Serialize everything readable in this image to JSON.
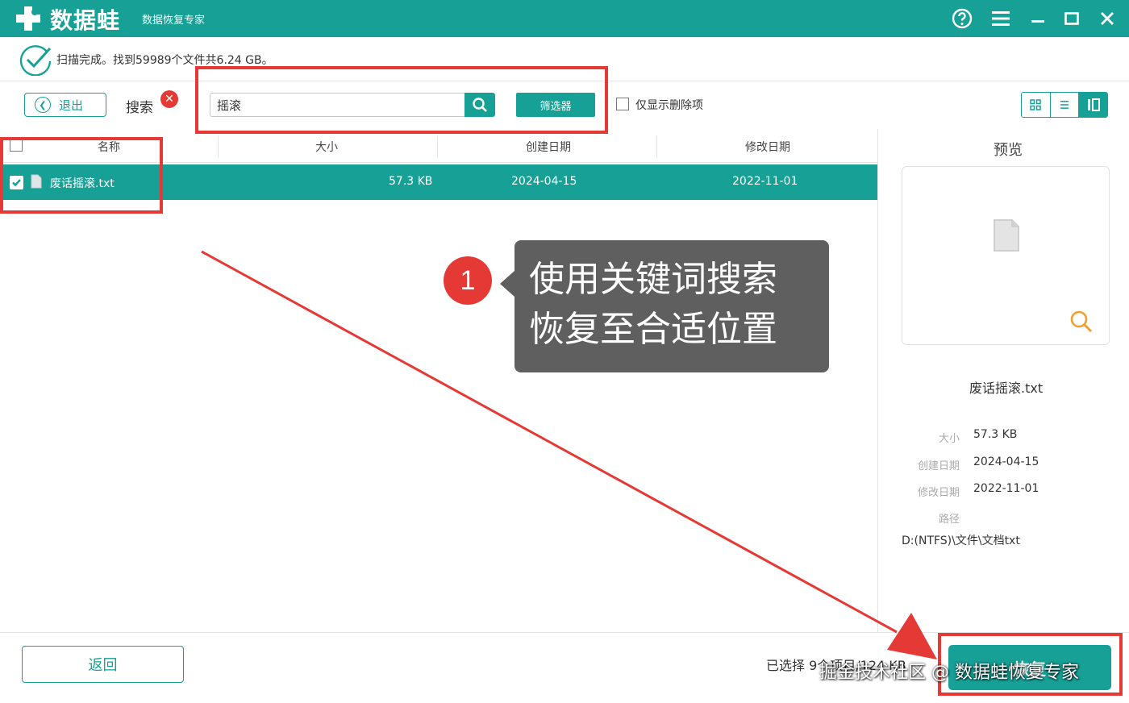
{
  "app": {
    "name": "数据蛙",
    "subtitle": "数据恢复专家"
  },
  "status": {
    "text": "扫描完成。找到59989个文件共6.24 GB。"
  },
  "toolbar": {
    "exit_label": "退出",
    "search_label": "搜索",
    "search_value": "摇滚",
    "filter_label": "筛选器",
    "only_deleted_label": "仅显示删除项"
  },
  "table": {
    "columns": [
      "名称",
      "大小",
      "创建日期",
      "修改日期"
    ],
    "rows": [
      {
        "name": "废话摇滚.txt",
        "size": "57.3 KB",
        "created": "2024-04-15",
        "modified": "2022-11-01",
        "checked": true
      }
    ]
  },
  "preview": {
    "title": "预览",
    "file_name": "废话摇滚.txt",
    "labels": {
      "size": "大小",
      "created": "创建日期",
      "modified": "修改日期",
      "path": "路径"
    },
    "values": {
      "size": "57.3 KB",
      "created": "2024-04-15",
      "modified": "2022-11-01",
      "path": "D:(NTFS)\\文件\\文档txt"
    }
  },
  "footer": {
    "back_label": "返回",
    "selected_info": "已选择 9个项目/124 KB",
    "recover_label": "恢复"
  },
  "annotation": {
    "badge": "1",
    "line1": "使用关键词搜索",
    "line2": "恢复至合适位置"
  },
  "watermark": "掘金技术社区 @ 数据蛙恢复专家",
  "colors": {
    "accent": "#16a096",
    "highlight": "#e53935",
    "callout_bg": "#5f5f5f"
  }
}
